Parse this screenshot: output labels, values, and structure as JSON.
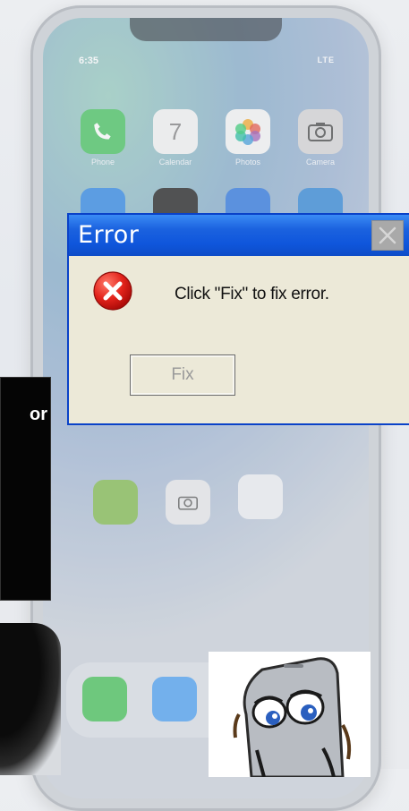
{
  "phone": {
    "status_time": "6:35",
    "status_right": "LTE",
    "apps_row1": [
      "Phone",
      "Calendar",
      "Photos",
      "Camera"
    ],
    "calendar_day": "7"
  },
  "dialog": {
    "title": "Error",
    "message": "Click \"Fix\" to fix error.",
    "fix_button": "Fix",
    "title_color": "#0f56dc",
    "body_color": "#ece9d8"
  },
  "side_panel": {
    "text": "or"
  },
  "icons": {
    "error": "error-x-icon",
    "close": "close-icon"
  }
}
